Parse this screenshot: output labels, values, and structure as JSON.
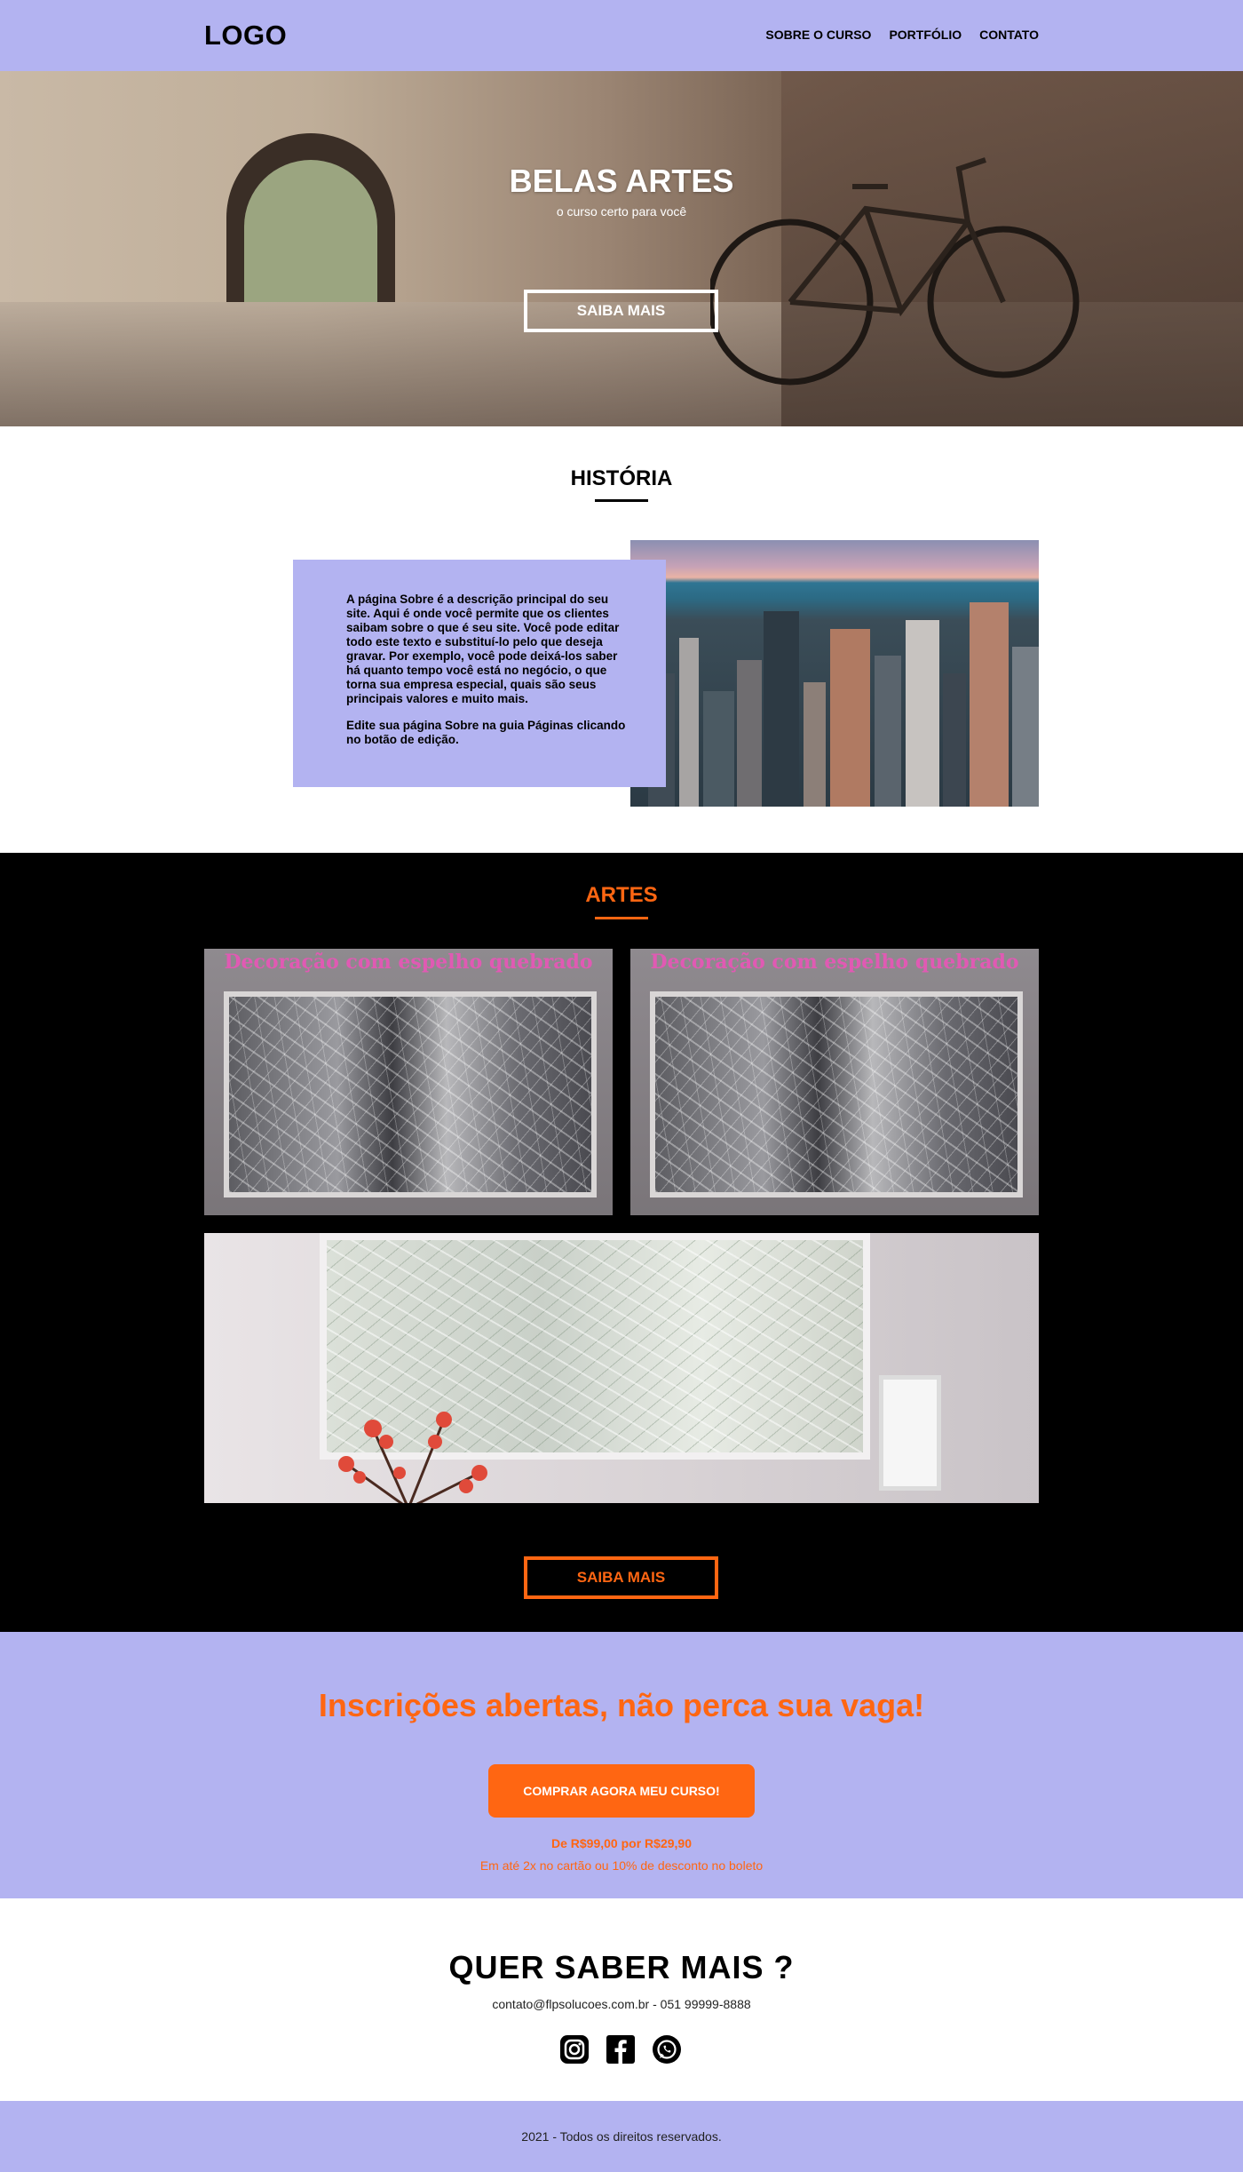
{
  "header": {
    "logo": "LOGO",
    "nav": [
      "SOBRE O CURSO",
      "PORTFÓLIO",
      "CONTATO"
    ]
  },
  "hero": {
    "title": "BELAS ARTES",
    "subtitle": "o curso certo para você",
    "button": "SAIBA MAIS"
  },
  "historia": {
    "title": "HISTÓRIA",
    "paragraphs": [
      "A página Sobre é a descrição principal do seu site. Aqui é onde você permite que os clientes saibam sobre o que é seu site. Você pode editar todo este texto e substituí-lo pelo que deseja gravar. Por exemplo, você pode deixá-los saber há quanto tempo você está no negócio, o que torna sua empresa especial, quais são seus principais valores e muito mais.",
      "Edite sua página Sobre na guia Páginas clicando no botão de edição."
    ]
  },
  "artes": {
    "title": "ARTES",
    "tiles": [
      {
        "caption": "Decoração com espelho quebrado"
      },
      {
        "caption": "Decoração com espelho quebrado"
      }
    ],
    "button": "SAIBA MAIS"
  },
  "inscricoes": {
    "title": "Inscrições abertas, não perca sua vaga!",
    "button": "COMPRAR AGORA MEU CURSO!",
    "price": "De R$99,00 por R$29,90",
    "note": "Em até 2x no cartão ou 10% de desconto no boleto"
  },
  "contato": {
    "title": "QUER SABER MAIS ?",
    "info": "contato@flpsolucoes.com.br - 051 99999-8888",
    "socials": [
      "instagram-icon",
      "facebook-icon",
      "whatsapp-icon"
    ]
  },
  "footer": {
    "text": "2021 - Todos os direitos reservados."
  },
  "colors": {
    "lavender": "#b3b3f1",
    "orange": "#ff6612",
    "black": "#000000"
  }
}
